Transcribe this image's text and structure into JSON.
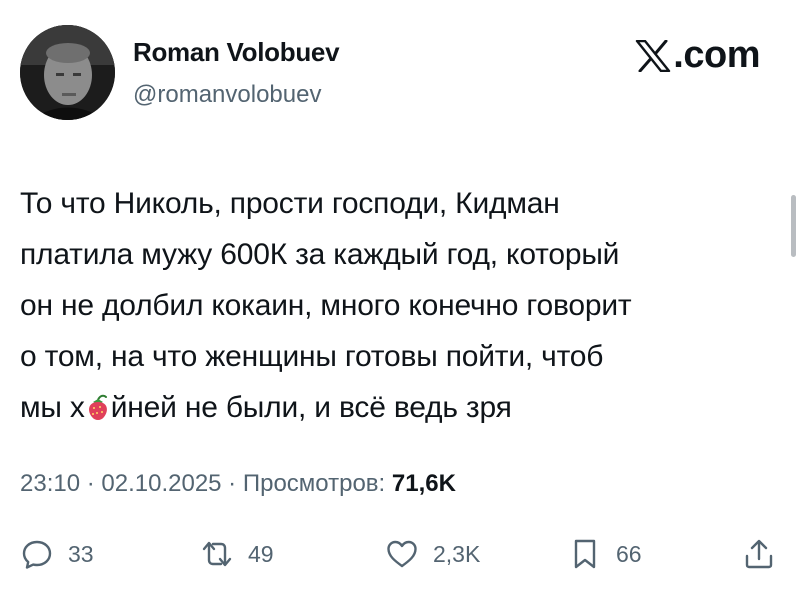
{
  "author": {
    "name": "Roman Volobuev",
    "handle": "@romanvolobuev"
  },
  "brand": {
    "suffix": ".com",
    "icon": "x-logo-icon"
  },
  "tweet": {
    "lines": [
      "То что Николь, прости господи, Кидман",
      "платила мужу 600К за каждый год, который",
      "он не долбил кокаин, много конечно говорит",
      "о том, на что женщины готовы пойти, чтоб"
    ],
    "last_line_before": "мы х",
    "last_line_emoji": "strawberry-icon",
    "last_line_after": "йней не были, и всё ведь зря"
  },
  "meta": {
    "time": "23:10",
    "separator1": " · ",
    "date": "02.10.2025",
    "separator2": " · ",
    "views_label": "Просмотров: ",
    "views_count": "71,6K"
  },
  "actions": {
    "replies": "33",
    "reposts": "49",
    "likes": "2,3K",
    "bookmarks": "66"
  },
  "colors": {
    "text": "#0f1419",
    "secondary": "#536471"
  }
}
